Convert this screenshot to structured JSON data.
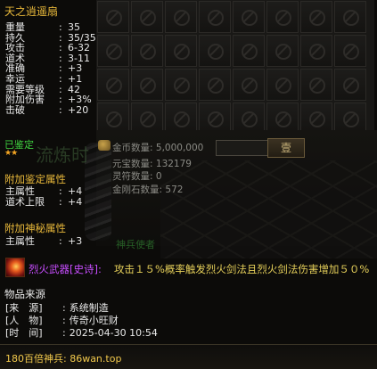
{
  "item": {
    "name": "天之逍遥扇",
    "stats": [
      {
        "key": "重量",
        "value": "35"
      },
      {
        "key": "持久",
        "value": "35/35"
      },
      {
        "key": "攻击",
        "value": "6-32"
      },
      {
        "key": "道术",
        "value": "3-11"
      },
      {
        "key": "准确",
        "value": "+3"
      },
      {
        "key": "幸运",
        "value": "+1"
      },
      {
        "key": "需要等级",
        "value": "42"
      },
      {
        "key": "附加伤害",
        "value": "+3%"
      },
      {
        "key": "击破",
        "value": "+20"
      }
    ],
    "colon": ":",
    "identified_label": "已鉴定",
    "stars": "★★",
    "identify_section": "附加鉴定属性",
    "identify_stats": [
      {
        "key": "主属性",
        "value": "+4"
      },
      {
        "key": "道术上限",
        "value": "+4"
      }
    ],
    "mystic_section": "附加神秘属性",
    "mystic_stats": [
      {
        "key": "主属性",
        "value": "+3"
      }
    ],
    "skill": {
      "name": "烈火武器[史诗]:",
      "description": "攻击１５%概率触发烈火剑法且烈火剑法伤害增加５０%"
    },
    "source": {
      "title": "物品来源",
      "rows": [
        {
          "key": "[来　源]",
          "value": "系统制造"
        },
        {
          "key": "[人　物]",
          "value": "传奇小旺财"
        },
        {
          "key": "[时　间]",
          "value": "2025-04-30 10:54"
        }
      ]
    },
    "footer": "180百倍神兵: 86wan.top"
  },
  "background": {
    "money": [
      {
        "label": "金币数量",
        "value": "5,000,000"
      },
      {
        "label": "元宝数量",
        "value": "132179"
      },
      {
        "label": "灵符数量",
        "value": "0"
      },
      {
        "label": "金刚石数量",
        "value": "572"
      }
    ],
    "confirm_button": "壹",
    "ghost_text": "流炼时",
    "npc_name": "神兵使者"
  },
  "colors": {
    "title": "#e8b83a",
    "stat_text": "#e9e9e9",
    "green": "#3fd13f",
    "skill_name": "#c84dff",
    "skill_desc": "#e6d05a",
    "footer": "#f2c94c"
  }
}
